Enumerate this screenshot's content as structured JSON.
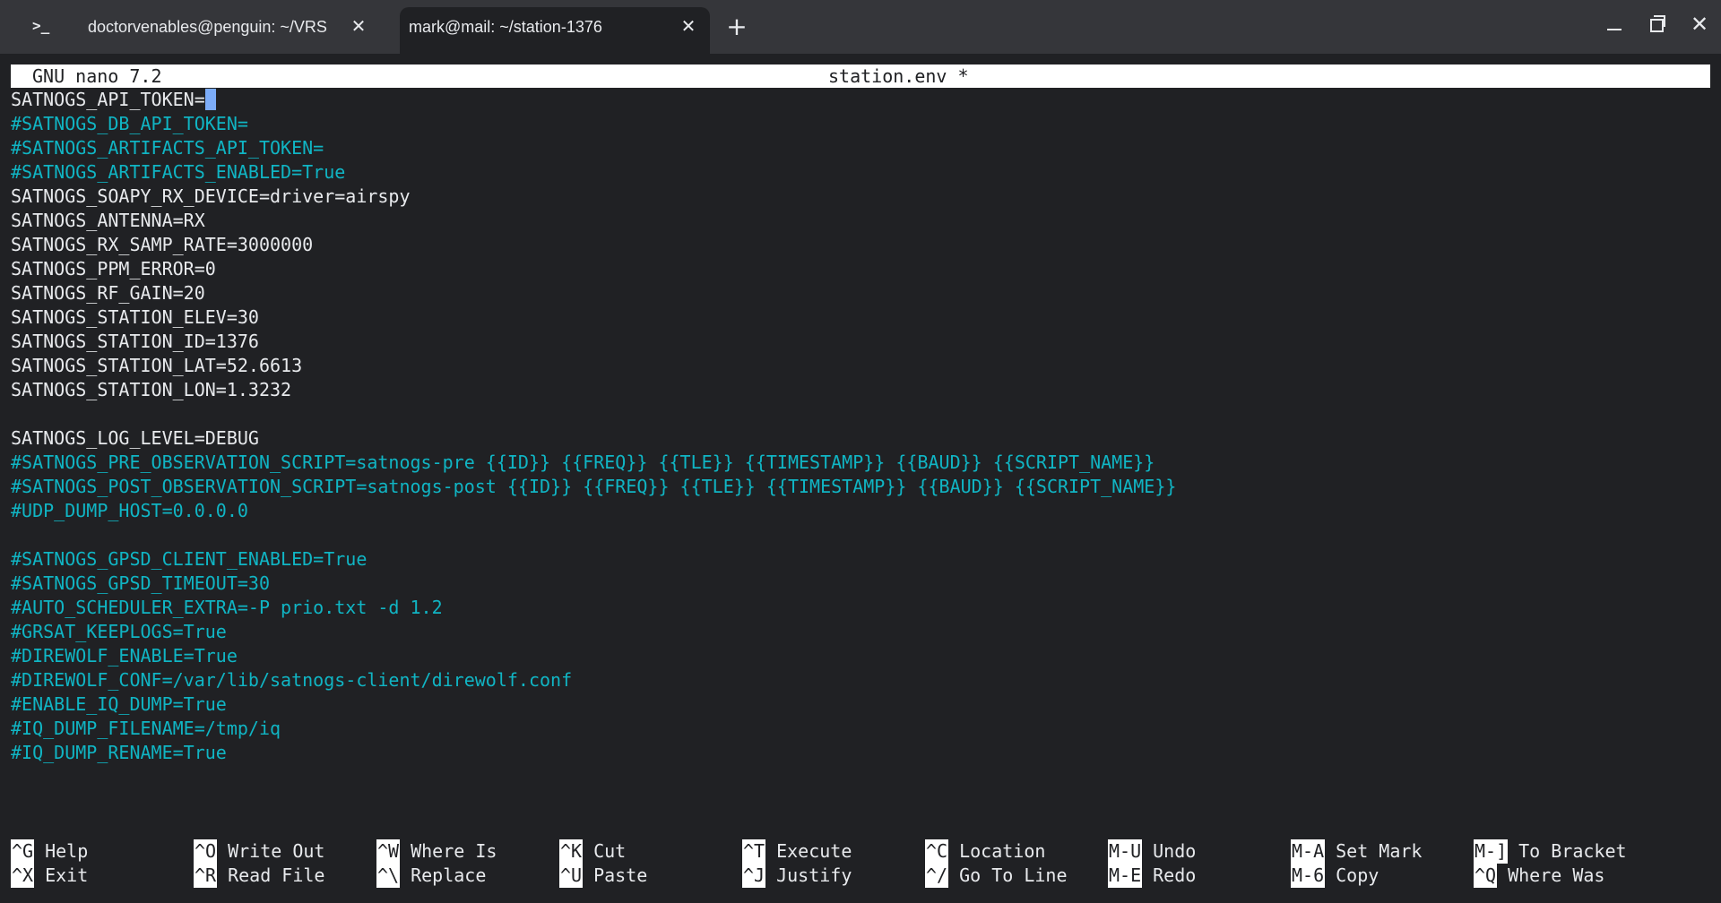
{
  "window": {
    "tabs": [
      {
        "label": "doctorvenables@penguin: ~/VRS",
        "active": false
      },
      {
        "label": "mark@mail: ~/station-1376",
        "active": true
      }
    ],
    "prompt_icon": ">_",
    "close_glyph": "✕",
    "new_tab_glyph": "+",
    "icons": [
      "terminal-prompt-icon",
      "close-icon",
      "plus-icon",
      "minimize-icon",
      "maximize-icon",
      "close-window-icon"
    ]
  },
  "nano": {
    "version": "GNU nano 7.2",
    "filename": "station.env *",
    "lines": [
      {
        "text": "SATNOGS_API_TOKEN=",
        "type": "plain",
        "cursor": true
      },
      {
        "text": "#SATNOGS_DB_API_TOKEN=",
        "type": "comment"
      },
      {
        "text": "#SATNOGS_ARTIFACTS_API_TOKEN=",
        "type": "comment"
      },
      {
        "text": "#SATNOGS_ARTIFACTS_ENABLED=True",
        "type": "comment"
      },
      {
        "text": "SATNOGS_SOAPY_RX_DEVICE=driver=airspy",
        "type": "plain"
      },
      {
        "text": "SATNOGS_ANTENNA=RX",
        "type": "plain"
      },
      {
        "text": "SATNOGS_RX_SAMP_RATE=3000000",
        "type": "plain"
      },
      {
        "text": "SATNOGS_PPM_ERROR=0",
        "type": "plain"
      },
      {
        "text": "SATNOGS_RF_GAIN=20",
        "type": "plain"
      },
      {
        "text": "SATNOGS_STATION_ELEV=30",
        "type": "plain"
      },
      {
        "text": "SATNOGS_STATION_ID=1376",
        "type": "plain"
      },
      {
        "text": "SATNOGS_STATION_LAT=52.6613",
        "type": "plain"
      },
      {
        "text": "SATNOGS_STATION_LON=1.3232",
        "type": "plain"
      },
      {
        "text": "",
        "type": "plain"
      },
      {
        "text": "SATNOGS_LOG_LEVEL=DEBUG",
        "type": "plain"
      },
      {
        "text": "#SATNOGS_PRE_OBSERVATION_SCRIPT=satnogs-pre {{ID}} {{FREQ}} {{TLE}} {{TIMESTAMP}} {{BAUD}} {{SCRIPT_NAME}}",
        "type": "comment"
      },
      {
        "text": "#SATNOGS_POST_OBSERVATION_SCRIPT=satnogs-post {{ID}} {{FREQ}} {{TLE}} {{TIMESTAMP}} {{BAUD}} {{SCRIPT_NAME}}",
        "type": "comment"
      },
      {
        "text": "#UDP_DUMP_HOST=0.0.0.0",
        "type": "comment"
      },
      {
        "text": "",
        "type": "plain"
      },
      {
        "text": "#SATNOGS_GPSD_CLIENT_ENABLED=True",
        "type": "comment"
      },
      {
        "text": "#SATNOGS_GPSD_TIMEOUT=30",
        "type": "comment"
      },
      {
        "text": "#AUTO_SCHEDULER_EXTRA=-P prio.txt -d 1.2",
        "type": "comment"
      },
      {
        "text": "#GRSAT_KEEPLOGS=True",
        "type": "comment"
      },
      {
        "text": "#DIREWOLF_ENABLE=True",
        "type": "comment"
      },
      {
        "text": "#DIREWOLF_CONF=/var/lib/satnogs-client/direwolf.conf",
        "type": "comment"
      },
      {
        "text": "#ENABLE_IQ_DUMP=True",
        "type": "comment"
      },
      {
        "text": "#IQ_DUMP_FILENAME=/tmp/iq",
        "type": "comment"
      },
      {
        "text": "#IQ_DUMP_RENAME=True",
        "type": "comment"
      }
    ],
    "shortcuts": [
      [
        {
          "key": "^G",
          "label": "Help"
        },
        {
          "key": "^X",
          "label": "Exit"
        }
      ],
      [
        {
          "key": "^O",
          "label": "Write Out"
        },
        {
          "key": "^R",
          "label": "Read File"
        }
      ],
      [
        {
          "key": "^W",
          "label": "Where Is"
        },
        {
          "key": "^\\",
          "label": "Replace"
        }
      ],
      [
        {
          "key": "^K",
          "label": "Cut"
        },
        {
          "key": "^U",
          "label": "Paste"
        }
      ],
      [
        {
          "key": "^T",
          "label": "Execute"
        },
        {
          "key": "^J",
          "label": "Justify"
        }
      ],
      [
        {
          "key": "^C",
          "label": "Location"
        },
        {
          "key": "^/",
          "label": "Go To Line"
        }
      ],
      [
        {
          "key": "M-U",
          "label": "Undo"
        },
        {
          "key": "M-E",
          "label": "Redo"
        }
      ],
      [
        {
          "key": "M-A",
          "label": "Set Mark"
        },
        {
          "key": "M-6",
          "label": "Copy"
        }
      ],
      [
        {
          "key": "M-]",
          "label": "To Bracket"
        },
        {
          "key": "^Q",
          "label": "Where Was"
        }
      ]
    ]
  },
  "colors": {
    "background": "#202124",
    "tabbar": "#35363a",
    "plain_text": "#e8eaed",
    "comment_text": "#10b5c4",
    "cursor": "#7cacf8",
    "header_bg": "#ffffff"
  }
}
